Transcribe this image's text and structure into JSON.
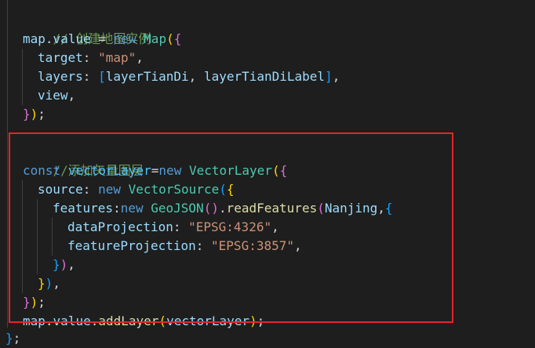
{
  "colors": {
    "background": "#1e1e1e",
    "comment": "#6a9955",
    "variable": "#9cdcfe",
    "keyword": "#569cd6",
    "class": "#4ec9b0",
    "function": "#dcdcaa",
    "string": "#ce9178",
    "highlight_border": "#e3262a"
  },
  "code": {
    "lines": [
      {
        "parts": [
          "// 创建地图实例"
        ]
      },
      {
        "parts": [
          "map",
          ".",
          "value",
          " = ",
          "new",
          " ",
          "Map",
          "(",
          "{"
        ]
      },
      {
        "parts": [
          "target",
          ": ",
          "\"map\"",
          ","
        ]
      },
      {
        "parts": [
          "layers",
          ": ",
          "[",
          "layerTianDi",
          ", ",
          "layerTianDiLabel",
          "]",
          ","
        ]
      },
      {
        "parts": [
          "view",
          ","
        ]
      },
      {
        "parts": [
          "}",
          ")",
          ";"
        ]
      },
      {
        "parts": [
          "//添加矢量图层"
        ]
      },
      {
        "parts": [
          "const",
          " ",
          "vectorLayer",
          "=",
          "new",
          " ",
          "VectorLayer",
          "(",
          "{"
        ]
      },
      {
        "parts": [
          "source",
          ": ",
          "new",
          " ",
          "VectorSource",
          "(",
          "{"
        ]
      },
      {
        "parts": [
          "features",
          ":",
          "new",
          " ",
          "GeoJSON",
          "(",
          ")",
          ".",
          "readFeatures",
          "(",
          "Nanjing",
          ",",
          "{"
        ]
      },
      {
        "parts": [
          "dataProjection",
          ": ",
          "\"EPSG:4326\"",
          ","
        ]
      },
      {
        "parts": [
          "featureProjection",
          ": ",
          "\"EPSG:3857\"",
          ","
        ]
      },
      {
        "parts": [
          "}",
          ")",
          ","
        ]
      },
      {
        "parts": [
          "}",
          ")",
          ","
        ]
      },
      {
        "parts": [
          "}",
          ")",
          ";"
        ]
      },
      {
        "parts": [
          "map",
          ".",
          "value",
          ".",
          "addLayer",
          "(",
          "vectorLayer",
          ")",
          ";"
        ]
      },
      {
        "parts": [
          "}",
          ";"
        ]
      }
    ]
  }
}
